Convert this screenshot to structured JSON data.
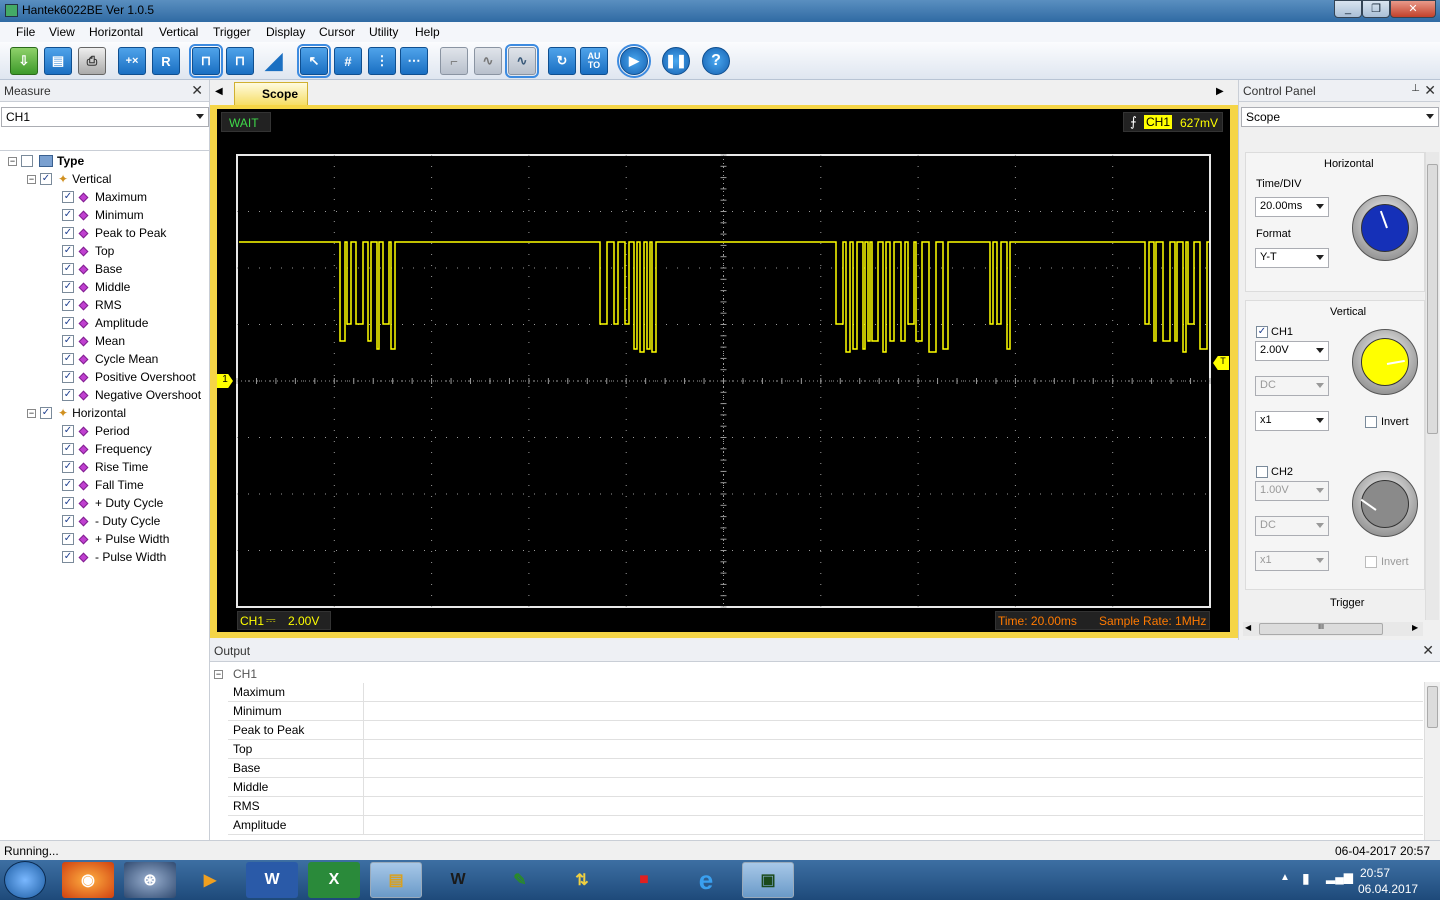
{
  "window": {
    "title": "Hantek6022BE Ver 1.0.5",
    "minimize": "_",
    "restore": "❐",
    "close": "✕"
  },
  "menu": [
    "File",
    "View",
    "Horizontal",
    "Vertical",
    "Trigger",
    "Display",
    "Cursor",
    "Utility",
    "Help"
  ],
  "toolbar": {
    "run_label": "R",
    "auto_label": "AU TO",
    "help_label": "?"
  },
  "measure": {
    "title": "Measure",
    "channel": "CH1",
    "root": "Type",
    "groups": [
      {
        "label": "Vertical",
        "items": [
          "Maximum",
          "Minimum",
          "Peak to Peak",
          "Top",
          "Base",
          "Middle",
          "RMS",
          "Amplitude",
          "Mean",
          "Cycle Mean",
          "Positive Overshoot",
          "Negative Overshoot"
        ]
      },
      {
        "label": "Horizontal",
        "items": [
          "Period",
          "Frequency",
          "Rise Time",
          "Fall Time",
          "+ Duty Cycle",
          "- Duty Cycle",
          "+ Pulse Width",
          "- Pulse Width"
        ]
      }
    ]
  },
  "tab": {
    "label": "Scope"
  },
  "scope": {
    "status": "WAIT",
    "trigger_channel": "CH1",
    "trigger_level": "627mV",
    "ch_label": "CH1",
    "ch_coupling_glyph": "⎓",
    "ch_scale": "2.00V",
    "time": "Time: 20.00ms",
    "sample_rate": "Sample Rate: 1MHz",
    "ch_marker": "1",
    "trig_marker": "T",
    "colors": {
      "trace": "#ffff00",
      "grid": "#9a9a9a",
      "time_text": "#ff7a00"
    }
  },
  "control_panel": {
    "title": "Control Panel",
    "mode": "Scope",
    "horizontal": {
      "title": "Horizontal",
      "time_div_label": "Time/DIV",
      "time_div": "20.00ms",
      "format_label": "Format",
      "format": "Y-T"
    },
    "vertical": {
      "title": "Vertical",
      "ch1": {
        "label": "CH1",
        "scale": "2.00V",
        "coupling": "DC",
        "probe": "x1",
        "invert": "Invert"
      },
      "ch2": {
        "label": "CH2",
        "scale": "1.00V",
        "coupling": "DC",
        "probe": "x1",
        "invert": "Invert"
      }
    },
    "trigger_title": "Trigger",
    "hscroll_grip": "III"
  },
  "output": {
    "title": "Output",
    "group": "CH1",
    "rows": [
      "Maximum",
      "Minimum",
      "Peak to Peak",
      "Top",
      "Base",
      "Middle",
      "RMS",
      "Amplitude"
    ]
  },
  "statusbar": {
    "left": "Running...",
    "date": "06-04-2017",
    "time": "20:57"
  },
  "taskbar": {
    "clock_time": "20:57",
    "clock_date": "06.04.2017"
  }
}
